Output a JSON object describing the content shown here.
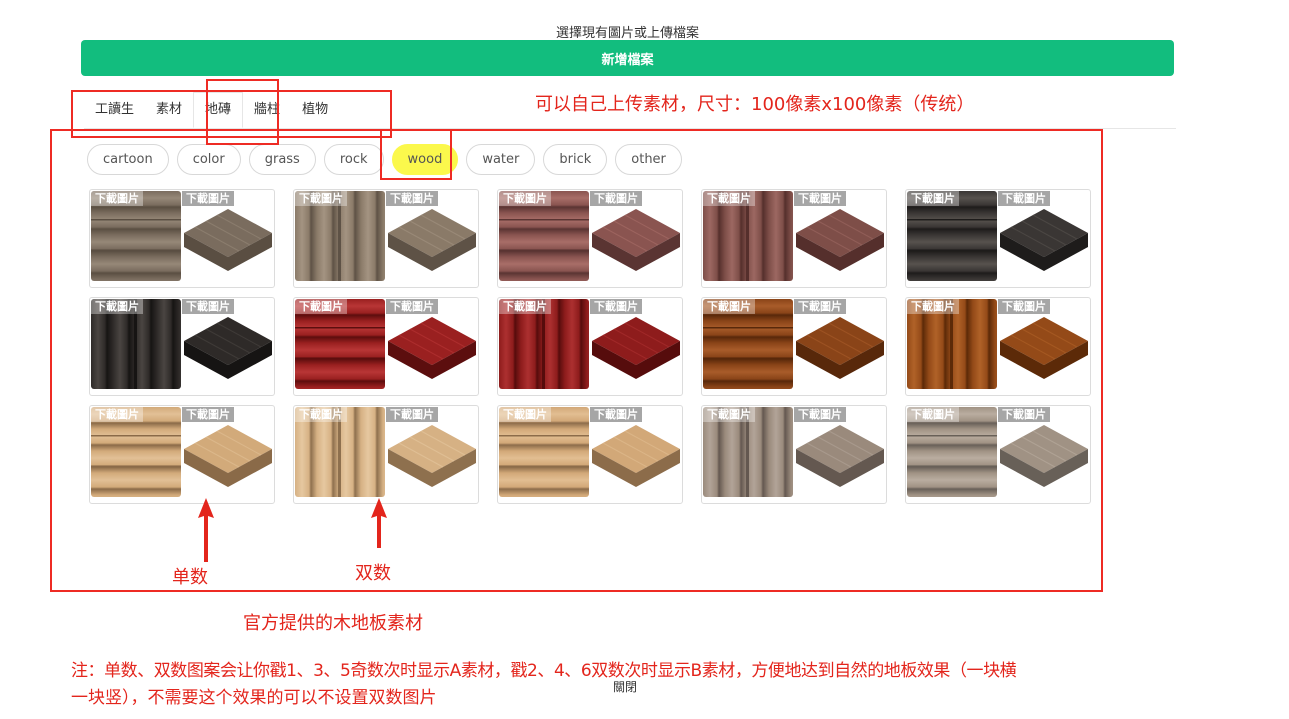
{
  "dialog": {
    "heading": "選擇現有圖片或上傳檔案",
    "add_button": "新增檔案",
    "close_label": "關閉"
  },
  "tabs": [
    {
      "label": "工讀生",
      "active": false
    },
    {
      "label": "素材",
      "active": false
    },
    {
      "label": "地磚",
      "active": true
    },
    {
      "label": "牆柱",
      "active": false
    },
    {
      "label": "植物",
      "active": false
    }
  ],
  "categories": [
    {
      "label": "cartoon",
      "active": false
    },
    {
      "label": "color",
      "active": false
    },
    {
      "label": "grass",
      "active": false
    },
    {
      "label": "rock",
      "active": false
    },
    {
      "label": "wood",
      "active": true
    },
    {
      "label": "water",
      "active": false
    },
    {
      "label": "brick",
      "active": false
    },
    {
      "label": "other",
      "active": false
    }
  ],
  "download_label": "下載圖片",
  "tiles": [
    {
      "base": "#7a6c5e",
      "dark": "#5a4e42",
      "light": "#968878"
    },
    {
      "base": "#8a7a68",
      "dark": "#5e5246",
      "light": "#a49482"
    },
    {
      "base": "#8a5450",
      "dark": "#5a3432",
      "light": "#a86e68"
    },
    {
      "base": "#7e4e48",
      "dark": "#552f2c",
      "light": "#9c6862"
    },
    {
      "base": "#3a3634",
      "dark": "#1e1c1b",
      "light": "#57524e"
    },
    {
      "base": "#2e2a28",
      "dark": "#161413",
      "light": "#4a4542"
    },
    {
      "base": "#9a2020",
      "dark": "#5c0e0e",
      "light": "#b83636"
    },
    {
      "base": "#8e1c1c",
      "dark": "#560c0c",
      "light": "#ac3030"
    },
    {
      "base": "#8a4418",
      "dark": "#58280a",
      "light": "#a85c2a"
    },
    {
      "base": "#944a18",
      "dark": "#5c2a08",
      "light": "#b06228"
    },
    {
      "base": "#d2aa7a",
      "dark": "#8a6a48",
      "light": "#e2c096"
    },
    {
      "base": "#d6b184",
      "dark": "#8e704e",
      "light": "#e6c8a0"
    },
    {
      "base": "#d2a878",
      "dark": "#8c6c4a",
      "light": "#e2be92"
    },
    {
      "base": "#9a8a7c",
      "dark": "#645850",
      "light": "#b2a498"
    },
    {
      "base": "#a09284",
      "dark": "#686058",
      "light": "#baada0"
    }
  ],
  "annotations": {
    "upload_hint": "可以自己上传素材，尺寸：100像素x100像素（传统）",
    "odd_label": "单数",
    "even_label": "双数",
    "caption": "官方提供的木地板素材",
    "note_line1": "注：单数、双数图案会让你戳1、3、5奇数次时显示A素材，戳2、4、6双数次时显示B素材，方便地达到自然的地板效果（一块横",
    "note_line2": "一块竖），不需要这个效果的可以不设置双数图片"
  },
  "colors": {
    "accent_green": "#12bd7e",
    "wood_chip_highlight": "#fbf84c",
    "annotation_red": "#e3251c"
  }
}
